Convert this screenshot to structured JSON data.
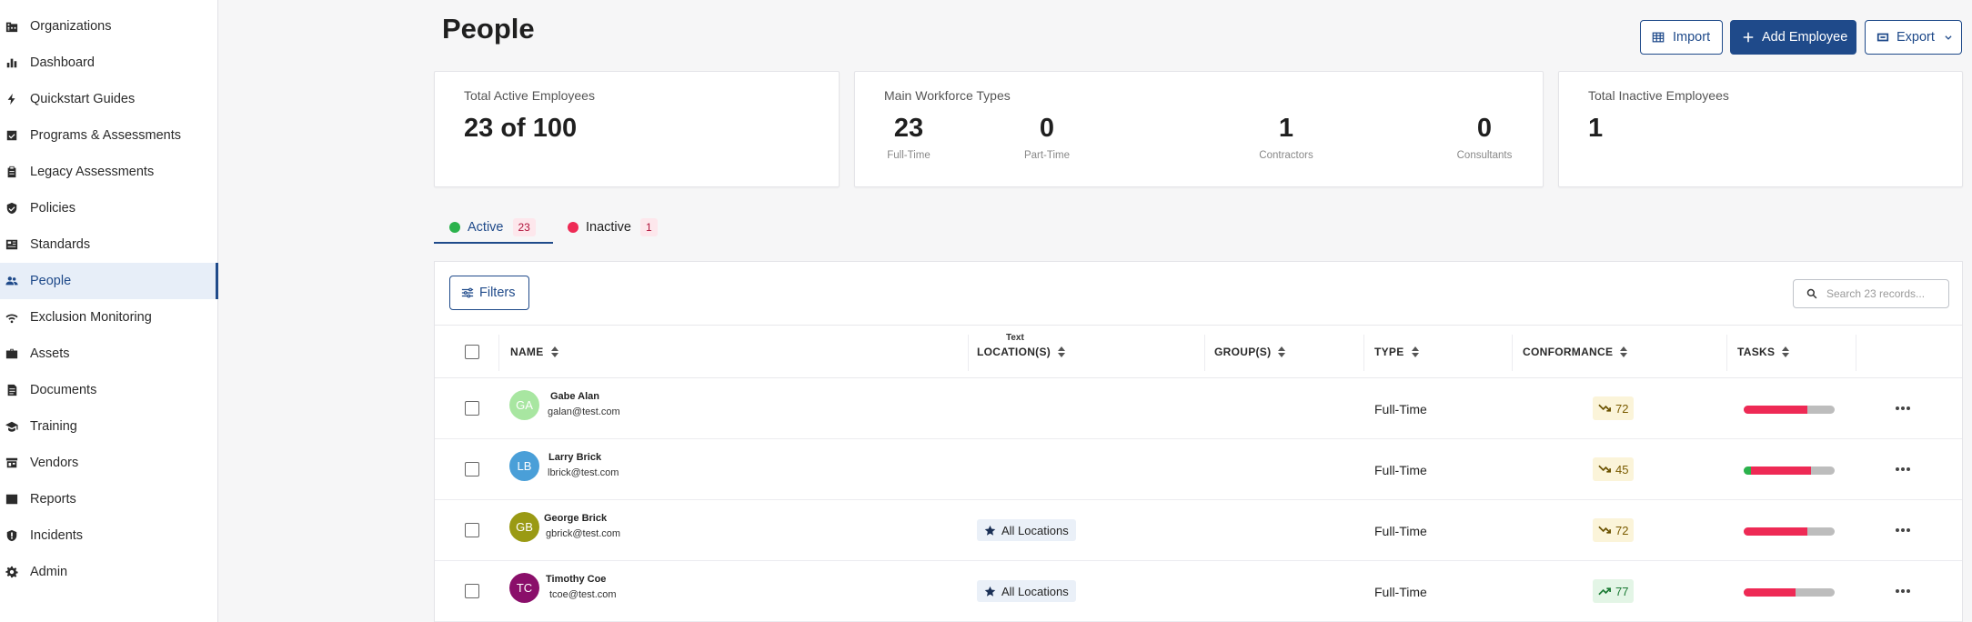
{
  "sidebar": {
    "items": [
      {
        "label": "Organizations",
        "icon": "building-icon"
      },
      {
        "label": "Dashboard",
        "icon": "bar-chart-icon"
      },
      {
        "label": "Quickstart Guides",
        "icon": "lightning-icon"
      },
      {
        "label": "Programs & Assessments",
        "icon": "checklist-icon"
      },
      {
        "label": "Legacy Assessments",
        "icon": "clipboard-icon"
      },
      {
        "label": "Policies",
        "icon": "shield-check-icon"
      },
      {
        "label": "Standards",
        "icon": "standards-icon"
      },
      {
        "label": "People",
        "icon": "people-icon",
        "active": true
      },
      {
        "label": "Exclusion Monitoring",
        "icon": "wifi-icon"
      },
      {
        "label": "Assets",
        "icon": "briefcase-icon"
      },
      {
        "label": "Documents",
        "icon": "document-icon"
      },
      {
        "label": "Training",
        "icon": "graduation-cap-icon"
      },
      {
        "label": "Vendors",
        "icon": "store-icon"
      },
      {
        "label": "Reports",
        "icon": "report-icon"
      },
      {
        "label": "Incidents",
        "icon": "shield-alert-icon"
      },
      {
        "label": "Admin",
        "icon": "gear-icon"
      }
    ]
  },
  "header": {
    "title": "People",
    "import_label": "Import",
    "add_employee_label": "Add Employee",
    "export_label": "Export"
  },
  "stats": {
    "total_active": {
      "title": "Total Active Employees",
      "value": "23 of 100"
    },
    "workforce": {
      "title": "Main Workforce Types",
      "types": [
        {
          "value": "23",
          "label": "Full-Time"
        },
        {
          "value": "0",
          "label": "Part-Time"
        },
        {
          "value": "1",
          "label": "Contractors"
        },
        {
          "value": "0",
          "label": "Consultants"
        }
      ]
    },
    "total_inactive": {
      "title": "Total Inactive Employees",
      "value": "1"
    }
  },
  "tabs": [
    {
      "label": "Active",
      "count": "23",
      "color": "#2bb24c"
    },
    {
      "label": "Inactive",
      "count": "1",
      "color": "#ee2a55"
    }
  ],
  "table": {
    "filters_label": "Filters",
    "search_placeholder": "Search 23 records...",
    "columns": {
      "name": "NAME",
      "location_small": "Text",
      "location": "LOCATION(S)",
      "groups": "GROUP(S)",
      "type": "TYPE",
      "conformance": "CONFORMANCE",
      "tasks": "TASKS"
    },
    "rows": [
      {
        "initials": "GA",
        "avatar_color": "#a8e6a1",
        "name": "Gabe Alan",
        "email": "galan@test.com",
        "location": "",
        "type": "Full-Time",
        "conformance": "72",
        "trend": "down",
        "tasks": {
          "green": 0,
          "red": 0.7
        }
      },
      {
        "initials": "LB",
        "avatar_color": "#4a9fd8",
        "name": "Larry Brick",
        "email": "lbrick@test.com",
        "location": "",
        "type": "Full-Time",
        "conformance": "45",
        "trend": "down",
        "tasks": {
          "green": 0.08,
          "red": 0.66
        }
      },
      {
        "initials": "GB",
        "avatar_color": "#9a9a14",
        "name": "George Brick",
        "email": "gbrick@test.com",
        "location": "All Locations",
        "type": "Full-Time",
        "conformance": "72",
        "trend": "down",
        "tasks": {
          "green": 0,
          "red": 0.7
        }
      },
      {
        "initials": "TC",
        "avatar_color": "#8a0f6a",
        "name": "Timothy Coe",
        "email": "tcoe@test.com",
        "location": "All Locations",
        "type": "Full-Time",
        "conformance": "77",
        "trend": "up",
        "tasks": {
          "green": 0,
          "red": 0.57
        }
      }
    ]
  },
  "colors": {
    "accent": "#1f4a8a",
    "task_red": "#ee2a55",
    "task_green": "#2bb24c",
    "task_grey": "#bdbdbd",
    "conf_down_bg": "#fbf4d9",
    "conf_up_bg": "#e3f5e6"
  }
}
